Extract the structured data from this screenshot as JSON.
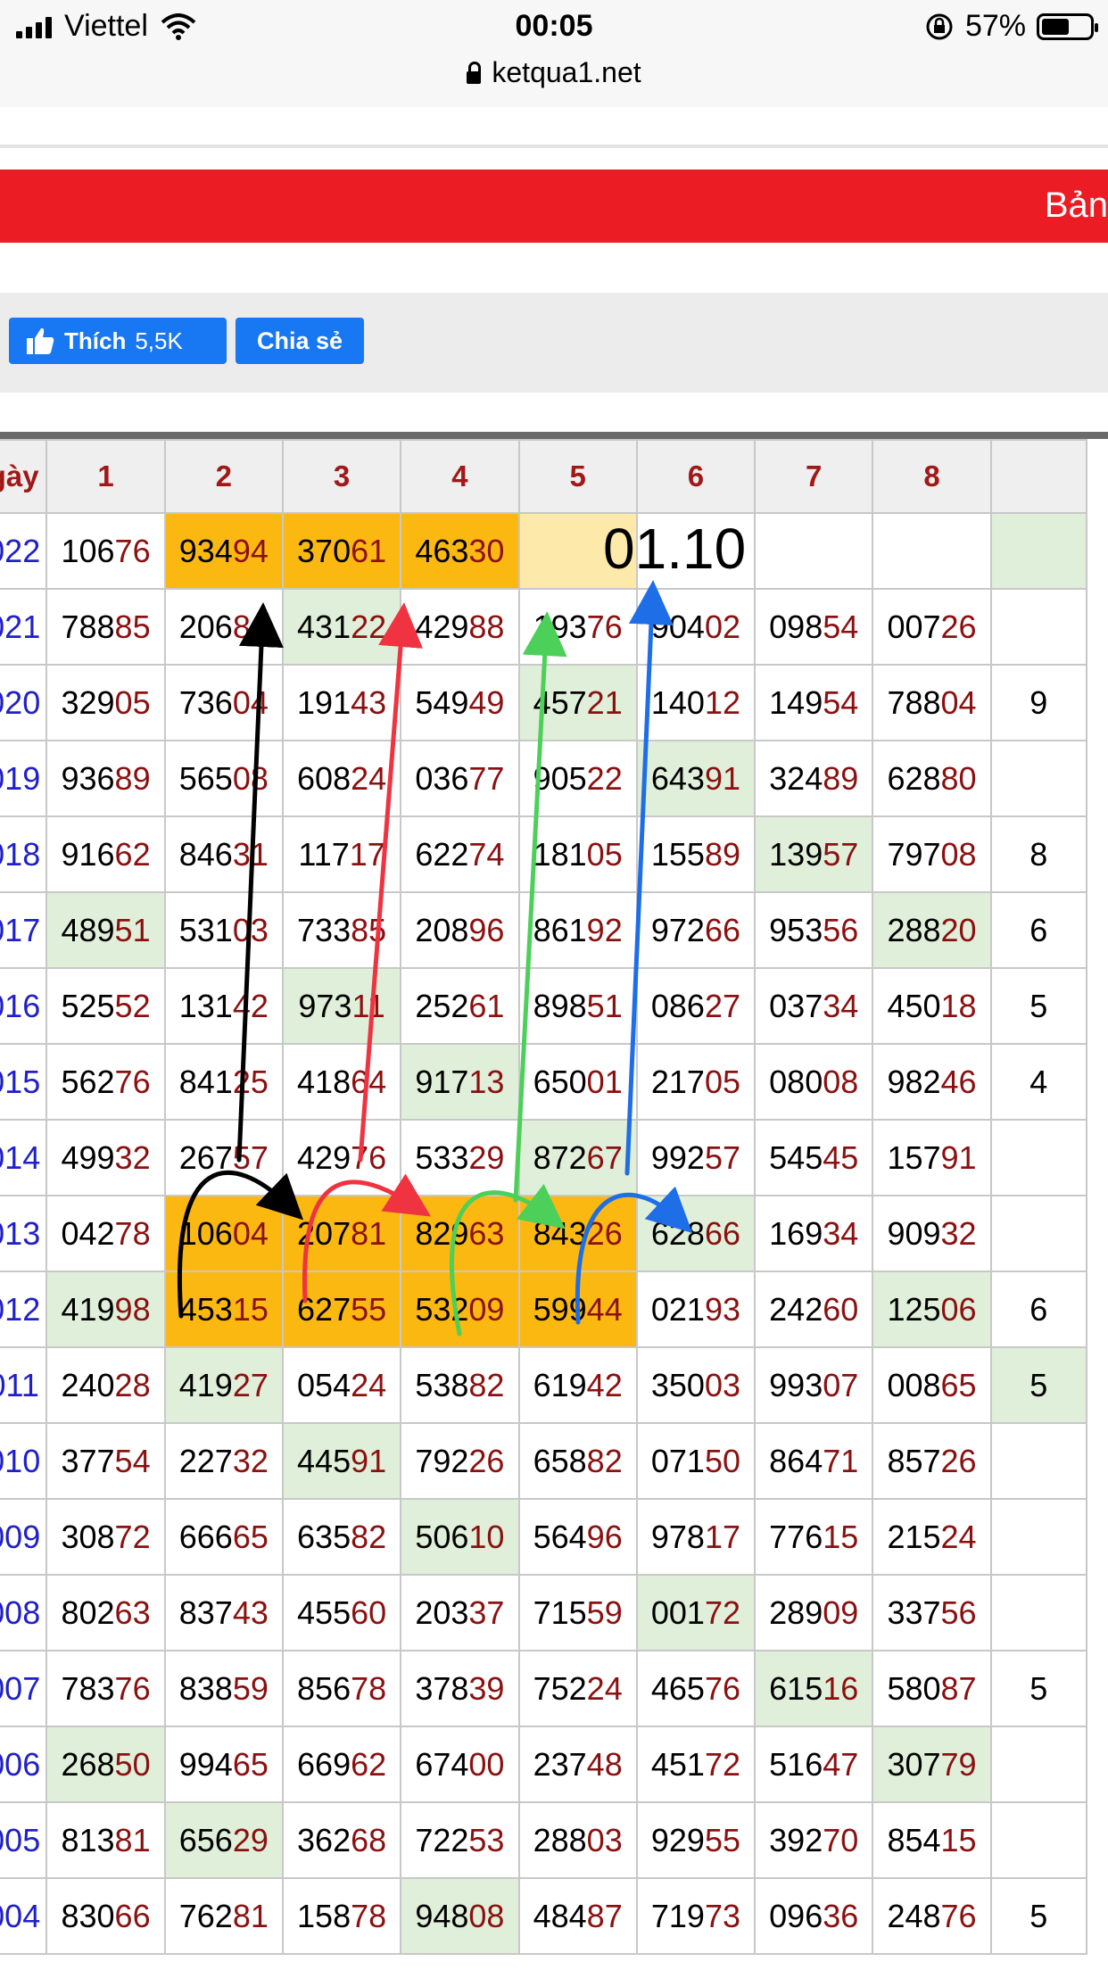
{
  "status_bar": {
    "carrier": "Viettel",
    "time": "00:05",
    "battery": "57%",
    "battery_level": 0.57,
    "icons": [
      "signal-icon",
      "wifi-icon",
      "rotation-lock-icon",
      "battery-icon"
    ]
  },
  "browser": {
    "url": "ketqua1.net",
    "icons": [
      "lock-icon"
    ]
  },
  "banner": {
    "title": "Bản"
  },
  "social": {
    "like_label": "Thích",
    "like_count": "5,5K",
    "share_label": "Chia sẻ",
    "color": "#1877f2"
  },
  "table": {
    "headers": [
      "gày",
      "1",
      "2",
      "3",
      "4",
      "5",
      "6",
      "7",
      "8",
      ""
    ],
    "overlay_text": "01.10",
    "rows": [
      {
        "date": "022",
        "cells": [
          [
            "106",
            "76"
          ],
          [
            "934",
            "94"
          ],
          [
            "370",
            "61"
          ],
          [
            "463",
            "30"
          ],
          [
            "",
            ""
          ],
          [
            "",
            ""
          ],
          [
            "",
            ""
          ],
          [
            "",
            ""
          ]
        ]
      },
      {
        "date": "021",
        "cells": [
          [
            "788",
            "85"
          ],
          [
            "206",
            "81"
          ],
          [
            "431",
            "22"
          ],
          [
            "429",
            "88"
          ],
          [
            "193",
            "76"
          ],
          [
            "904",
            "02"
          ],
          [
            "098",
            "54"
          ],
          [
            "007",
            "26"
          ]
        ]
      },
      {
        "date": "020",
        "cells": [
          [
            "329",
            "05"
          ],
          [
            "736",
            "04"
          ],
          [
            "191",
            "43"
          ],
          [
            "549",
            "49"
          ],
          [
            "457",
            "21"
          ],
          [
            "140",
            "12"
          ],
          [
            "149",
            "54"
          ],
          [
            "788",
            "04"
          ],
          [
            "9",
            ""
          ]
        ]
      },
      {
        "date": "019",
        "cells": [
          [
            "936",
            "89"
          ],
          [
            "565",
            "08"
          ],
          [
            "608",
            "24"
          ],
          [
            "036",
            "77"
          ],
          [
            "905",
            "22"
          ],
          [
            "643",
            "91"
          ],
          [
            "324",
            "89"
          ],
          [
            "628",
            "80"
          ]
        ]
      },
      {
        "date": "018",
        "cells": [
          [
            "916",
            "62"
          ],
          [
            "846",
            "31"
          ],
          [
            "117",
            "17"
          ],
          [
            "622",
            "74"
          ],
          [
            "181",
            "05"
          ],
          [
            "155",
            "89"
          ],
          [
            "139",
            "57"
          ],
          [
            "797",
            "08"
          ],
          [
            "8",
            ""
          ]
        ]
      },
      {
        "date": "017",
        "cells": [
          [
            "489",
            "51"
          ],
          [
            "531",
            "03"
          ],
          [
            "733",
            "85"
          ],
          [
            "208",
            "96"
          ],
          [
            "861",
            "92"
          ],
          [
            "972",
            "66"
          ],
          [
            "953",
            "56"
          ],
          [
            "288",
            "20"
          ],
          [
            "6",
            ""
          ]
        ]
      },
      {
        "date": "016",
        "cells": [
          [
            "525",
            "52"
          ],
          [
            "131",
            "42"
          ],
          [
            "973",
            "11"
          ],
          [
            "252",
            "61"
          ],
          [
            "898",
            "51"
          ],
          [
            "086",
            "27"
          ],
          [
            "037",
            "34"
          ],
          [
            "450",
            "18"
          ],
          [
            "5",
            ""
          ]
        ]
      },
      {
        "date": "015",
        "cells": [
          [
            "562",
            "76"
          ],
          [
            "841",
            "25"
          ],
          [
            "418",
            "64"
          ],
          [
            "917",
            "13"
          ],
          [
            "650",
            "01"
          ],
          [
            "217",
            "05"
          ],
          [
            "080",
            "08"
          ],
          [
            "982",
            "46"
          ],
          [
            "4",
            ""
          ]
        ]
      },
      {
        "date": "014",
        "cells": [
          [
            "499",
            "32"
          ],
          [
            "267",
            "57"
          ],
          [
            "429",
            "76"
          ],
          [
            "533",
            "29"
          ],
          [
            "872",
            "67"
          ],
          [
            "992",
            "57"
          ],
          [
            "545",
            "45"
          ],
          [
            "157",
            "91"
          ]
        ]
      },
      {
        "date": "013",
        "cells": [
          [
            "042",
            "78"
          ],
          [
            "106",
            "04"
          ],
          [
            "207",
            "81"
          ],
          [
            "829",
            "63"
          ],
          [
            "843",
            "26"
          ],
          [
            "628",
            "66"
          ],
          [
            "169",
            "34"
          ],
          [
            "909",
            "32"
          ]
        ]
      },
      {
        "date": "012",
        "cells": [
          [
            "419",
            "98"
          ],
          [
            "453",
            "15"
          ],
          [
            "627",
            "55"
          ],
          [
            "532",
            "09"
          ],
          [
            "599",
            "44"
          ],
          [
            "021",
            "93"
          ],
          [
            "242",
            "60"
          ],
          [
            "125",
            "06"
          ],
          [
            "6",
            ""
          ]
        ]
      },
      {
        "date": "011",
        "cells": [
          [
            "240",
            "28"
          ],
          [
            "419",
            "27"
          ],
          [
            "054",
            "24"
          ],
          [
            "538",
            "82"
          ],
          [
            "619",
            "42"
          ],
          [
            "350",
            "03"
          ],
          [
            "993",
            "07"
          ],
          [
            "008",
            "65"
          ],
          [
            "5",
            ""
          ]
        ]
      },
      {
        "date": "010",
        "cells": [
          [
            "377",
            "54"
          ],
          [
            "227",
            "32"
          ],
          [
            "445",
            "91"
          ],
          [
            "792",
            "26"
          ],
          [
            "658",
            "82"
          ],
          [
            "071",
            "50"
          ],
          [
            "864",
            "71"
          ],
          [
            "857",
            "26"
          ]
        ]
      },
      {
        "date": "009",
        "cells": [
          [
            "308",
            "72"
          ],
          [
            "666",
            "65"
          ],
          [
            "635",
            "82"
          ],
          [
            "506",
            "10"
          ],
          [
            "564",
            "96"
          ],
          [
            "978",
            "17"
          ],
          [
            "776",
            "15"
          ],
          [
            "215",
            "24"
          ]
        ]
      },
      {
        "date": "008",
        "cells": [
          [
            "802",
            "63"
          ],
          [
            "837",
            "43"
          ],
          [
            "455",
            "60"
          ],
          [
            "203",
            "37"
          ],
          [
            "715",
            "59"
          ],
          [
            "001",
            "72"
          ],
          [
            "289",
            "09"
          ],
          [
            "337",
            "56"
          ]
        ]
      },
      {
        "date": "007",
        "cells": [
          [
            "783",
            "76"
          ],
          [
            "838",
            "59"
          ],
          [
            "856",
            "78"
          ],
          [
            "378",
            "39"
          ],
          [
            "752",
            "24"
          ],
          [
            "465",
            "76"
          ],
          [
            "615",
            "16"
          ],
          [
            "580",
            "87"
          ],
          [
            "5",
            ""
          ]
        ]
      },
      {
        "date": "006",
        "cells": [
          [
            "268",
            "50"
          ],
          [
            "994",
            "65"
          ],
          [
            "669",
            "62"
          ],
          [
            "674",
            "00"
          ],
          [
            "237",
            "48"
          ],
          [
            "451",
            "72"
          ],
          [
            "516",
            "47"
          ],
          [
            "307",
            "79"
          ]
        ]
      },
      {
        "date": "005",
        "cells": [
          [
            "813",
            "81"
          ],
          [
            "656",
            "29"
          ],
          [
            "362",
            "68"
          ],
          [
            "722",
            "53"
          ],
          [
            "288",
            "03"
          ],
          [
            "929",
            "55"
          ],
          [
            "392",
            "70"
          ],
          [
            "854",
            "15"
          ]
        ]
      },
      {
        "date": "004",
        "cells": [
          [
            "830",
            "66"
          ],
          [
            "762",
            "81"
          ],
          [
            "158",
            "78"
          ],
          [
            "948",
            "08"
          ],
          [
            "484",
            "87"
          ],
          [
            "719",
            "73"
          ],
          [
            "096",
            "36"
          ],
          [
            "248",
            "76"
          ],
          [
            "5",
            ""
          ]
        ]
      }
    ]
  },
  "colors": {
    "red_banner": "#ec1c24",
    "orange_highlight": "#fbb811",
    "green_highlight": "#e0efd9",
    "yellow_highlight": "#fde9a9",
    "last_two_digits": "#8b1010",
    "date_blue": "#2020c8",
    "arrow_black": "#000000",
    "arrow_red": "#ef3340",
    "arrow_green": "#4cd05a",
    "arrow_blue": "#1e6ee8"
  }
}
